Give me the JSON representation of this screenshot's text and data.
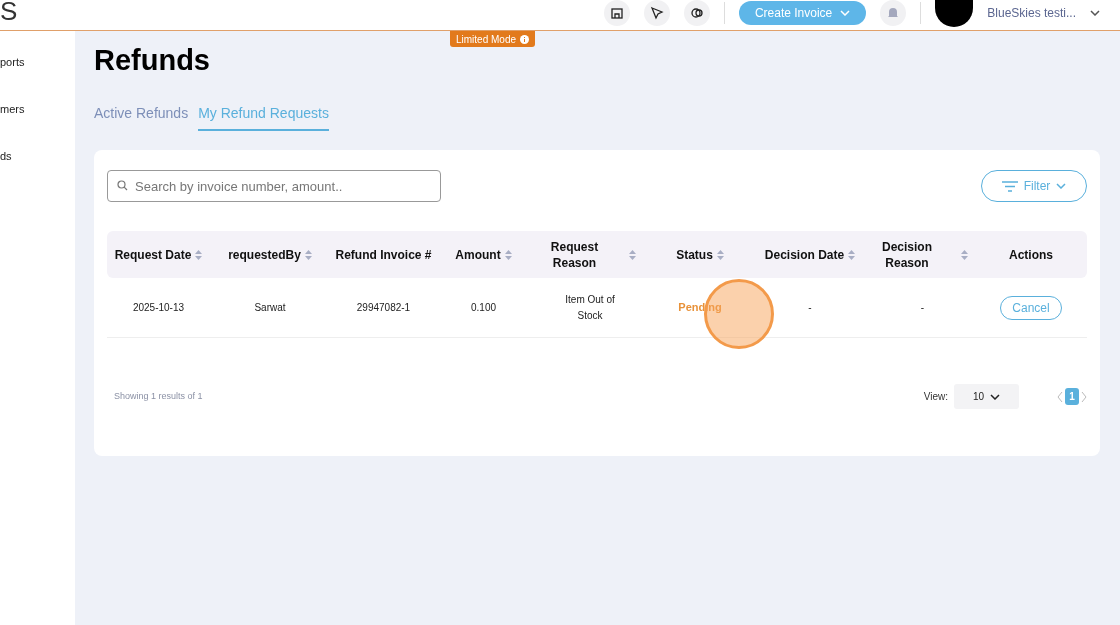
{
  "header": {
    "logo_text": "S",
    "create_button": "Create Invoice",
    "account_name": "BlueSkies testi..."
  },
  "sidebar": {
    "items": [
      {
        "label": "ports"
      },
      {
        "label": "mers"
      },
      {
        "label": "ds"
      }
    ]
  },
  "mode_badge": "Limited Mode",
  "page_title": "Refunds",
  "tabs": [
    {
      "label": "Active Refunds",
      "selected": false
    },
    {
      "label": "My Refund Requests",
      "selected": true
    }
  ],
  "search": {
    "placeholder": "Search by invoice number, amount.."
  },
  "filter_button": "Filter",
  "table": {
    "columns": [
      {
        "label": "Request Date",
        "sortable": true
      },
      {
        "label": "requestedBy",
        "sortable": true
      },
      {
        "label": "Refund Invoice #",
        "sortable": false
      },
      {
        "label": "Amount",
        "sortable": true
      },
      {
        "label": "Request Reason",
        "sortable": true
      },
      {
        "label": "Status",
        "sortable": true
      },
      {
        "label": "Decision Date",
        "sortable": true
      },
      {
        "label": "Decision Reason",
        "sortable": true
      },
      {
        "label": "Actions",
        "sortable": false
      }
    ],
    "rows": [
      {
        "cells": [
          "2025-10-13",
          "Sarwat",
          "29947082-1",
          "0.100",
          "Item Out of Stock",
          "Pending",
          "-",
          "-"
        ],
        "action": "Cancel"
      }
    ]
  },
  "footer": {
    "summary": "Showing 1 results of 1",
    "view_label": "View:",
    "page_size": "10",
    "pages": [
      {
        "label": "1",
        "selected": true
      }
    ]
  }
}
